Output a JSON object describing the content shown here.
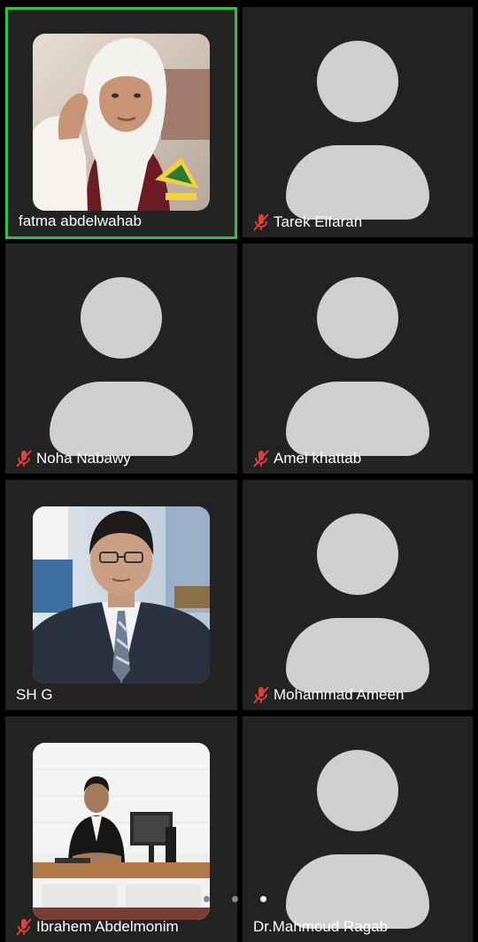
{
  "participants": [
    {
      "name": "fatma abdelwahab",
      "muted": false,
      "active_speaker": true,
      "avatar": "photo-woman-hijab"
    },
    {
      "name": "Tarek Elfaran",
      "muted": true,
      "active_speaker": false,
      "avatar": "default-avatar"
    },
    {
      "name": "Noha Nabawy",
      "muted": true,
      "active_speaker": false,
      "avatar": "default-avatar"
    },
    {
      "name": "Amel khattab",
      "muted": true,
      "active_speaker": false,
      "avatar": "default-avatar"
    },
    {
      "name": "SH G",
      "muted": false,
      "active_speaker": false,
      "avatar": "photo-man-suit"
    },
    {
      "name": "Mohammad Ameen",
      "muted": true,
      "active_speaker": false,
      "avatar": "default-avatar"
    },
    {
      "name": "Ibrahem Abdelmonim",
      "muted": true,
      "active_speaker": false,
      "avatar": "photo-man-desk"
    },
    {
      "name": "Dr.Mahmoud Ragab",
      "muted": false,
      "active_speaker": false,
      "avatar": "default-avatar"
    }
  ],
  "pagination": {
    "pages": 3,
    "current": 3
  },
  "colors": {
    "tile_bg": "#232323",
    "active_border": "#2fc14a",
    "avatar_placeholder": "#cfcfcf",
    "muted_icon": "#e0413a",
    "name_text": "#ffffff"
  }
}
